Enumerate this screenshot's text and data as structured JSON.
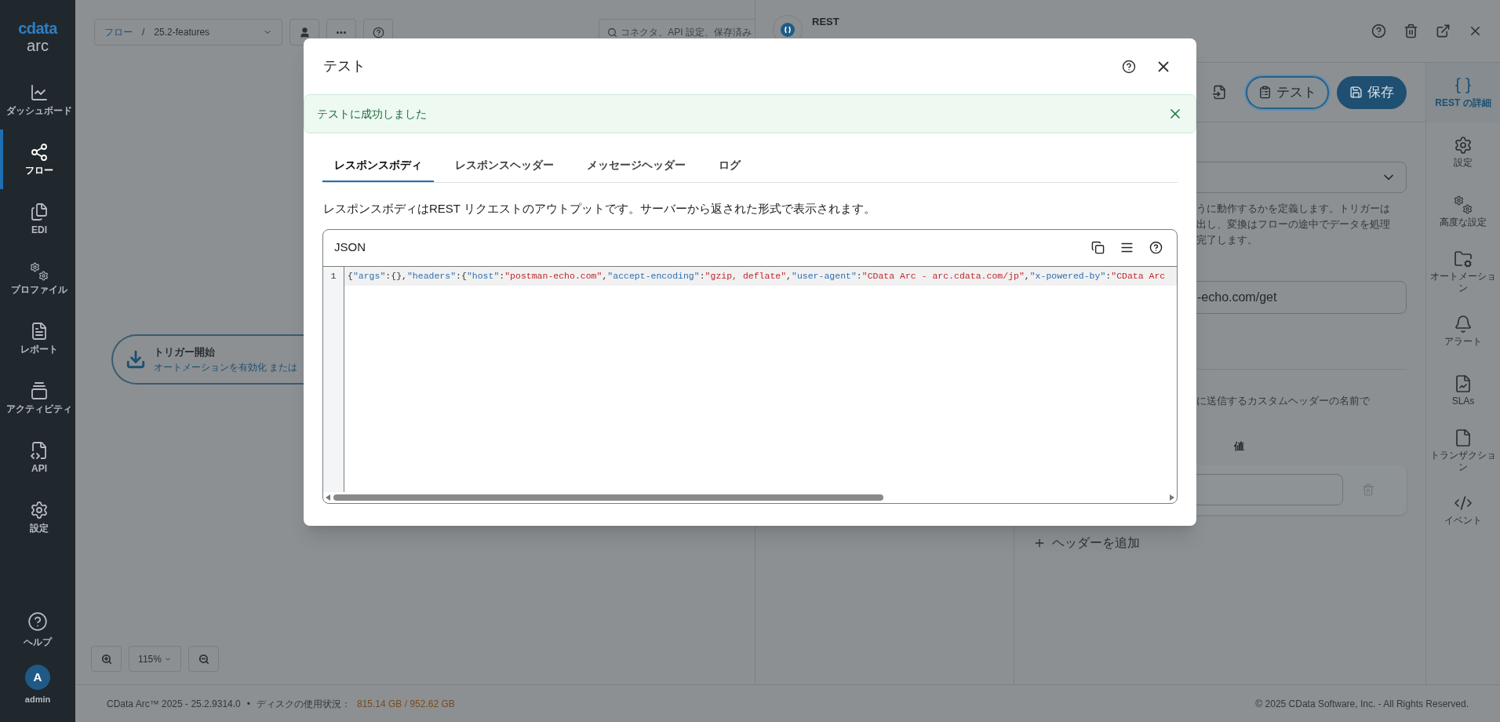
{
  "sidebar": {
    "logo": "cdata",
    "product": "arc",
    "items": [
      {
        "label": "ダッシュボード",
        "selected": false
      },
      {
        "label": "フロー",
        "selected": true
      },
      {
        "label": "EDI",
        "selected": false
      },
      {
        "label": "プロファイル",
        "selected": false
      },
      {
        "label": "レポート",
        "selected": false
      },
      {
        "label": "アクティビティ",
        "selected": false
      },
      {
        "label": "API",
        "selected": false
      },
      {
        "label": "設定",
        "selected": false
      }
    ],
    "help": "ヘルプ",
    "user": {
      "initial": "A",
      "name": "admin"
    }
  },
  "canvas": {
    "breadcrumb": {
      "root": "フロー",
      "separator": "/",
      "current": "25.2-features"
    },
    "search": {
      "placeholder": "コネクタ、API 設定、保存済み"
    },
    "trigger_node": {
      "title": "トリガー開始",
      "subtitle": "オートメーションを有効化 または"
    },
    "zoom": {
      "level": "115%"
    }
  },
  "panel": {
    "title": "REST",
    "test_button": "テスト",
    "save_button": "保存",
    "nav": [
      {
        "label": "REST の詳細",
        "selected": true
      },
      {
        "label": "設定",
        "selected": false
      },
      {
        "label": "高度な設定",
        "selected": false
      },
      {
        "label": "オートメーション",
        "selected": false
      },
      {
        "label": "アラート",
        "selected": false
      },
      {
        "label": "SLAs",
        "selected": false
      },
      {
        "label": "トランザクション",
        "selected": false
      },
      {
        "label": "イベント",
        "selected": false
      }
    ],
    "description_lines": [
      "うに動作するかを定義します。トリガーは",
      "出し、変換はフローの途中でデータを処理",
      "完了します。"
    ],
    "url_value": "-echo.com/get",
    "headers_hint": "に送信するカスタムヘッダーの名前で",
    "value_column": "値",
    "add_header": "ヘッダーを追加"
  },
  "modal": {
    "title": "テスト",
    "alert": "テストに成功しました",
    "tabs": [
      {
        "label": "レスポンスボディ",
        "selected": true
      },
      {
        "label": "レスポンスヘッダー",
        "selected": false
      },
      {
        "label": "メッセージヘッダー",
        "selected": false
      },
      {
        "label": "ログ",
        "selected": false
      }
    ],
    "description": "レスポンスボディはREST リクエストのアウトプットです。サーバーから返された形式で表示されます。",
    "editor": {
      "language": "JSON",
      "lines": [
        {
          "number": "1",
          "tokens": [
            {
              "kind": "punct",
              "text": "{"
            },
            {
              "kind": "key",
              "text": "\"args\""
            },
            {
              "kind": "punct",
              "text": ":{},"
            },
            {
              "kind": "key",
              "text": "\"headers\""
            },
            {
              "kind": "punct",
              "text": ":{"
            },
            {
              "kind": "key",
              "text": "\"host\""
            },
            {
              "kind": "punct",
              "text": ":"
            },
            {
              "kind": "string",
              "text": "\"postman-echo.com\""
            },
            {
              "kind": "punct",
              "text": ","
            },
            {
              "kind": "key",
              "text": "\"accept-encoding\""
            },
            {
              "kind": "punct",
              "text": ":"
            },
            {
              "kind": "string",
              "text": "\"gzip, deflate\""
            },
            {
              "kind": "punct",
              "text": ","
            },
            {
              "kind": "key",
              "text": "\"user-agent\""
            },
            {
              "kind": "punct",
              "text": ":"
            },
            {
              "kind": "string",
              "text": "\"CData Arc - arc.cdata.com/jp\""
            },
            {
              "kind": "punct",
              "text": ","
            },
            {
              "kind": "key",
              "text": "\"x-powered-by\""
            },
            {
              "kind": "punct",
              "text": ":"
            },
            {
              "kind": "string",
              "text": "\"CData Arc"
            }
          ]
        }
      ]
    }
  },
  "status_bar": {
    "version": "CData Arc™ 2025 - 25.2.9314.0",
    "bullet": "•",
    "disk_label": "ディスクの使用状況：",
    "disk_value": "815.14 GB / 952.62 GB",
    "copyright": "© 2025 CData Software, Inc. - All Rights Reserved."
  }
}
